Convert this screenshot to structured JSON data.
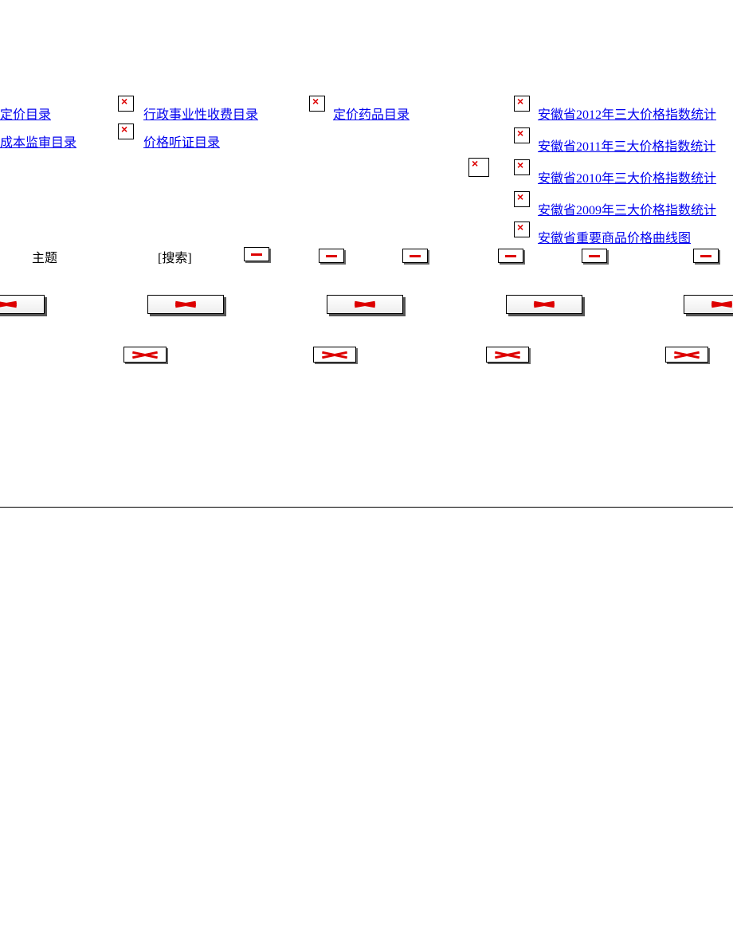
{
  "links": {
    "col1": {
      "row1": "定价目录",
      "row2": "成本监审目录"
    },
    "col2": {
      "row1": "行政事业性收费目录",
      "row2": "价格听证目录"
    },
    "col3": {
      "row1": "定价药品目录"
    },
    "col4": {
      "r1": "安徽省2012年三大价格指数统计",
      "r2": "安徽省2011年三大价格指数统计",
      "r3": "安徽省2010年三大价格指数统计",
      "r4": "安徽省2009年三大价格指数统计",
      "r5": "安徽省重要商品价格曲线图"
    }
  },
  "search": {
    "label": "主题",
    "button": "[搜索]"
  }
}
